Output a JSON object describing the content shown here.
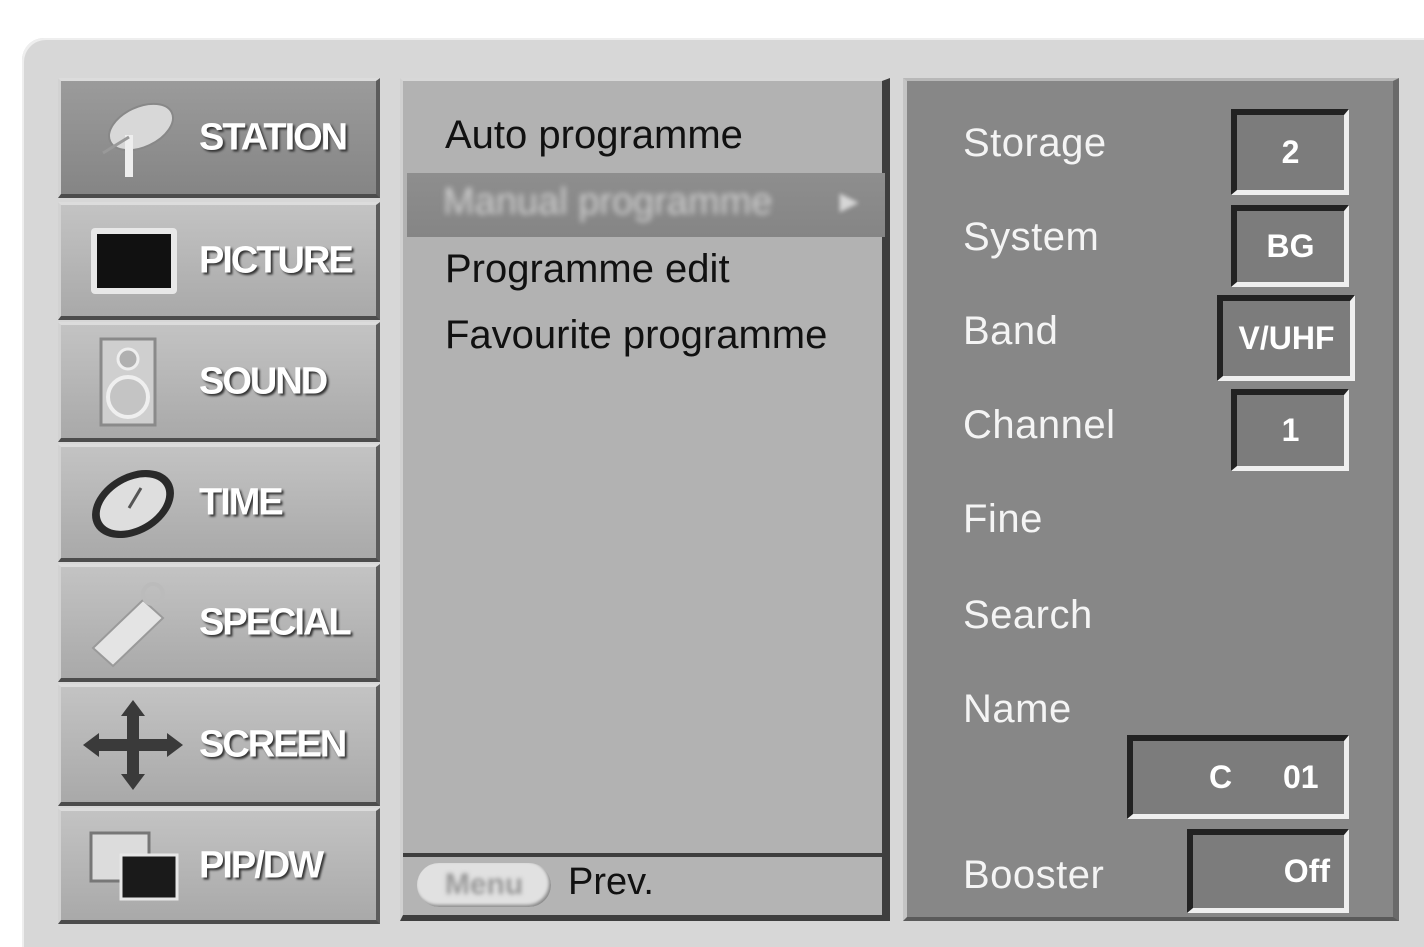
{
  "categories": [
    {
      "label": "STATION",
      "icon": "satellite-dish-icon",
      "active": true
    },
    {
      "label": "PICTURE",
      "icon": "tv-screen-icon",
      "active": false
    },
    {
      "label": "SOUND",
      "icon": "speaker-icon",
      "active": false
    },
    {
      "label": "TIME",
      "icon": "clock-icon",
      "active": false
    },
    {
      "label": "SPECIAL",
      "icon": "tag-icon",
      "active": false
    },
    {
      "label": "SCREEN",
      "icon": "move-arrows-icon",
      "active": false
    },
    {
      "label": "PIP/DW",
      "icon": "pip-windows-icon",
      "active": false
    }
  ],
  "submenu": {
    "items": [
      "Auto programme",
      "Manual programme",
      "Programme edit",
      "Favourite programme"
    ],
    "selected_index": 1,
    "menu_button": "Menu",
    "prev_label": "Prev."
  },
  "settings": {
    "storage": {
      "label": "Storage",
      "value": "2"
    },
    "system": {
      "label": "System",
      "value": "BG"
    },
    "band": {
      "label": "Band",
      "value": "V/UHF"
    },
    "channel": {
      "label": "Channel",
      "value": "1"
    },
    "fine": {
      "label": "Fine"
    },
    "search": {
      "label": "Search"
    },
    "name": {
      "label": "Name",
      "value_prefix": "C",
      "value_number": "01"
    },
    "booster": {
      "label": "Booster",
      "value": "Off"
    }
  }
}
